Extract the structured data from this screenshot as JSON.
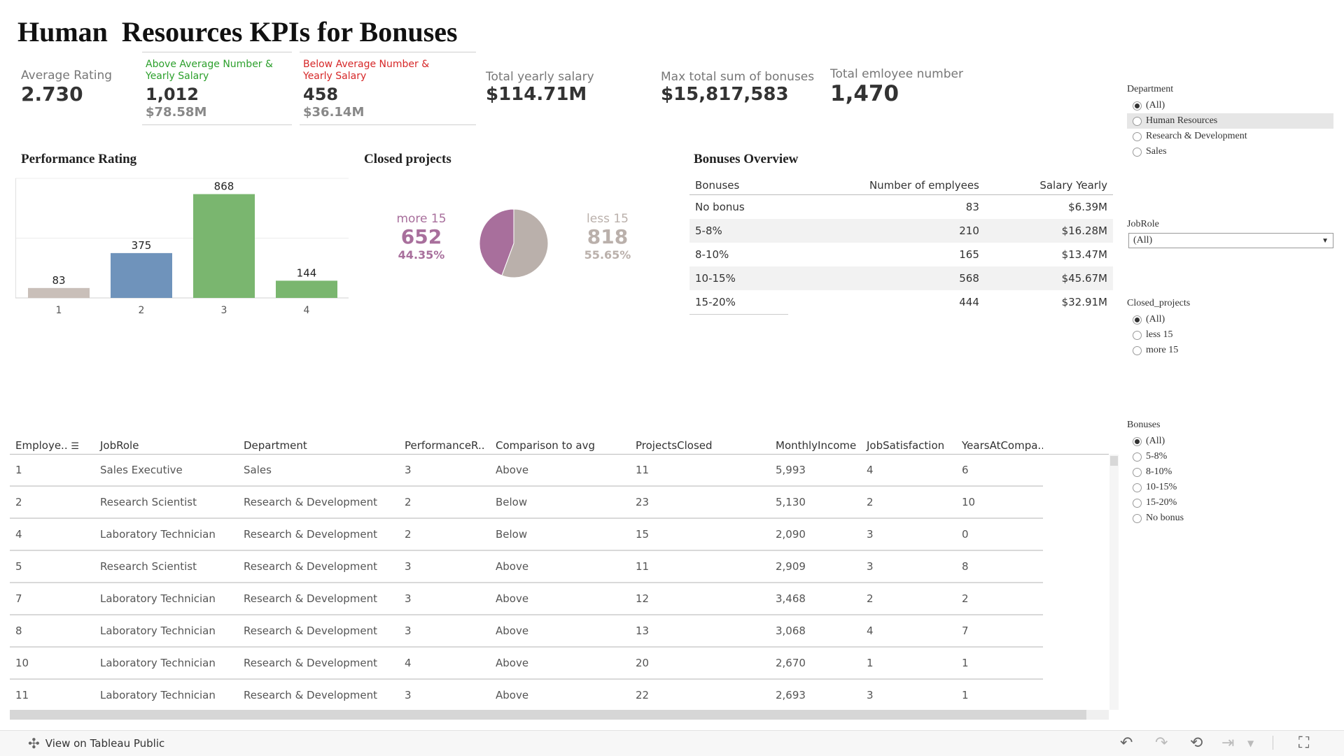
{
  "title": "Human  Resources KPIs for Bonuses",
  "kpis": {
    "avg_rating": {
      "label": "Average Rating",
      "value": "2.730"
    },
    "above": {
      "label": "Above Average Number & Yearly Salary",
      "count": "1,012",
      "salary": "$78.58M",
      "color": "#2ca02c"
    },
    "below": {
      "label": "Below Average  Number & Yearly Salary",
      "count": "458",
      "salary": "$36.14M",
      "color": "#d62728"
    },
    "total_salary": {
      "label": "Total yearly salary",
      "value": "$114.71M"
    },
    "max_bonus": {
      "label": "Max total sum of  bonuses",
      "value": "$15,817,583"
    },
    "total_employees": {
      "label": "Total emloyee number",
      "value": "1,470"
    }
  },
  "performance": {
    "title": "Performance Rating",
    "chart_data": {
      "type": "bar",
      "categories": [
        "1",
        "2",
        "3",
        "4"
      ],
      "values": [
        83,
        375,
        868,
        144
      ],
      "colors": [
        "#c9bfb9",
        "#6f93bb",
        "#7ab66f",
        "#7ab66f"
      ],
      "ylim": [
        0,
        1000
      ],
      "grid": true
    }
  },
  "closed_projects": {
    "title": "Closed projects",
    "more": {
      "label": "more 15",
      "count": "652",
      "pct": "44.35%",
      "color": "#a86f9c"
    },
    "less": {
      "label": "less 15",
      "count": "818",
      "pct": "55.65%",
      "color": "#bab0ab"
    },
    "chart_data": {
      "type": "pie",
      "categories": [
        "more 15",
        "less 15"
      ],
      "values": [
        652,
        818
      ],
      "colors": [
        "#a86f9c",
        "#bab0ab"
      ]
    }
  },
  "bonuses_overview": {
    "title": "Bonuses Overview",
    "columns": [
      "Bonuses",
      "Number of emplyees",
      "Salary Yearly"
    ],
    "rows": [
      [
        "No bonus",
        "83",
        "$6.39M"
      ],
      [
        "5-8%",
        "210",
        "$16.28M"
      ],
      [
        "8-10%",
        "165",
        "$13.47M"
      ],
      [
        "10-15%",
        "568",
        "$45.67M"
      ],
      [
        "15-20%",
        "444",
        "$32.91M"
      ]
    ]
  },
  "filters": {
    "department": {
      "title": "Department",
      "options": [
        "(All)",
        "Human Resources",
        "Research & Development",
        "Sales"
      ],
      "selected": 0,
      "hover": 1
    },
    "jobrole": {
      "title": "JobRole",
      "value": "(All)"
    },
    "closed_projects": {
      "title": "Closed_projects",
      "options": [
        "(All)",
        "less 15",
        "more 15"
      ],
      "selected": 0
    },
    "bonuses": {
      "title": "Bonuses",
      "options": [
        "(All)",
        "5-8%",
        "8-10%",
        "10-15%",
        "15-20%",
        "No bonus"
      ],
      "selected": 0
    }
  },
  "table": {
    "columns": [
      "Employe..",
      "JobRole",
      "Department",
      "PerformanceR..",
      "Comparison to avg",
      "ProjectsClosed",
      "MonthlyIncome",
      "JobSatisfaction",
      "YearsAtCompa.."
    ],
    "rows": [
      [
        "1",
        "Sales Executive",
        "Sales",
        "3",
        "Above",
        "11",
        "5,993",
        "4",
        "6"
      ],
      [
        "2",
        "Research Scientist",
        "Research & Development",
        "2",
        "Below",
        "23",
        "5,130",
        "2",
        "10"
      ],
      [
        "4",
        "Laboratory Technician",
        "Research & Development",
        "2",
        "Below",
        "15",
        "2,090",
        "3",
        "0"
      ],
      [
        "5",
        "Research Scientist",
        "Research & Development",
        "3",
        "Above",
        "11",
        "2,909",
        "3",
        "8"
      ],
      [
        "7",
        "Laboratory Technician",
        "Research & Development",
        "3",
        "Above",
        "12",
        "3,468",
        "2",
        "2"
      ],
      [
        "8",
        "Laboratory Technician",
        "Research & Development",
        "3",
        "Above",
        "13",
        "3,068",
        "4",
        "7"
      ],
      [
        "10",
        "Laboratory Technician",
        "Research & Development",
        "4",
        "Above",
        "20",
        "2,670",
        "1",
        "1"
      ],
      [
        "11",
        "Laboratory Technician",
        "Research & Development",
        "3",
        "Above",
        "22",
        "2,693",
        "3",
        "1"
      ]
    ]
  },
  "toolbar": {
    "view_label": "View on Tableau Public"
  },
  "icons": {
    "sort": "sort-icon",
    "tableau": "tableau-logo-icon",
    "undo": "undo-icon",
    "redo": "redo-icon",
    "revert": "revert-icon",
    "pause": "pause-icon",
    "fullscreen": "fullscreen-icon",
    "dropdown": "chevron-down-icon"
  }
}
